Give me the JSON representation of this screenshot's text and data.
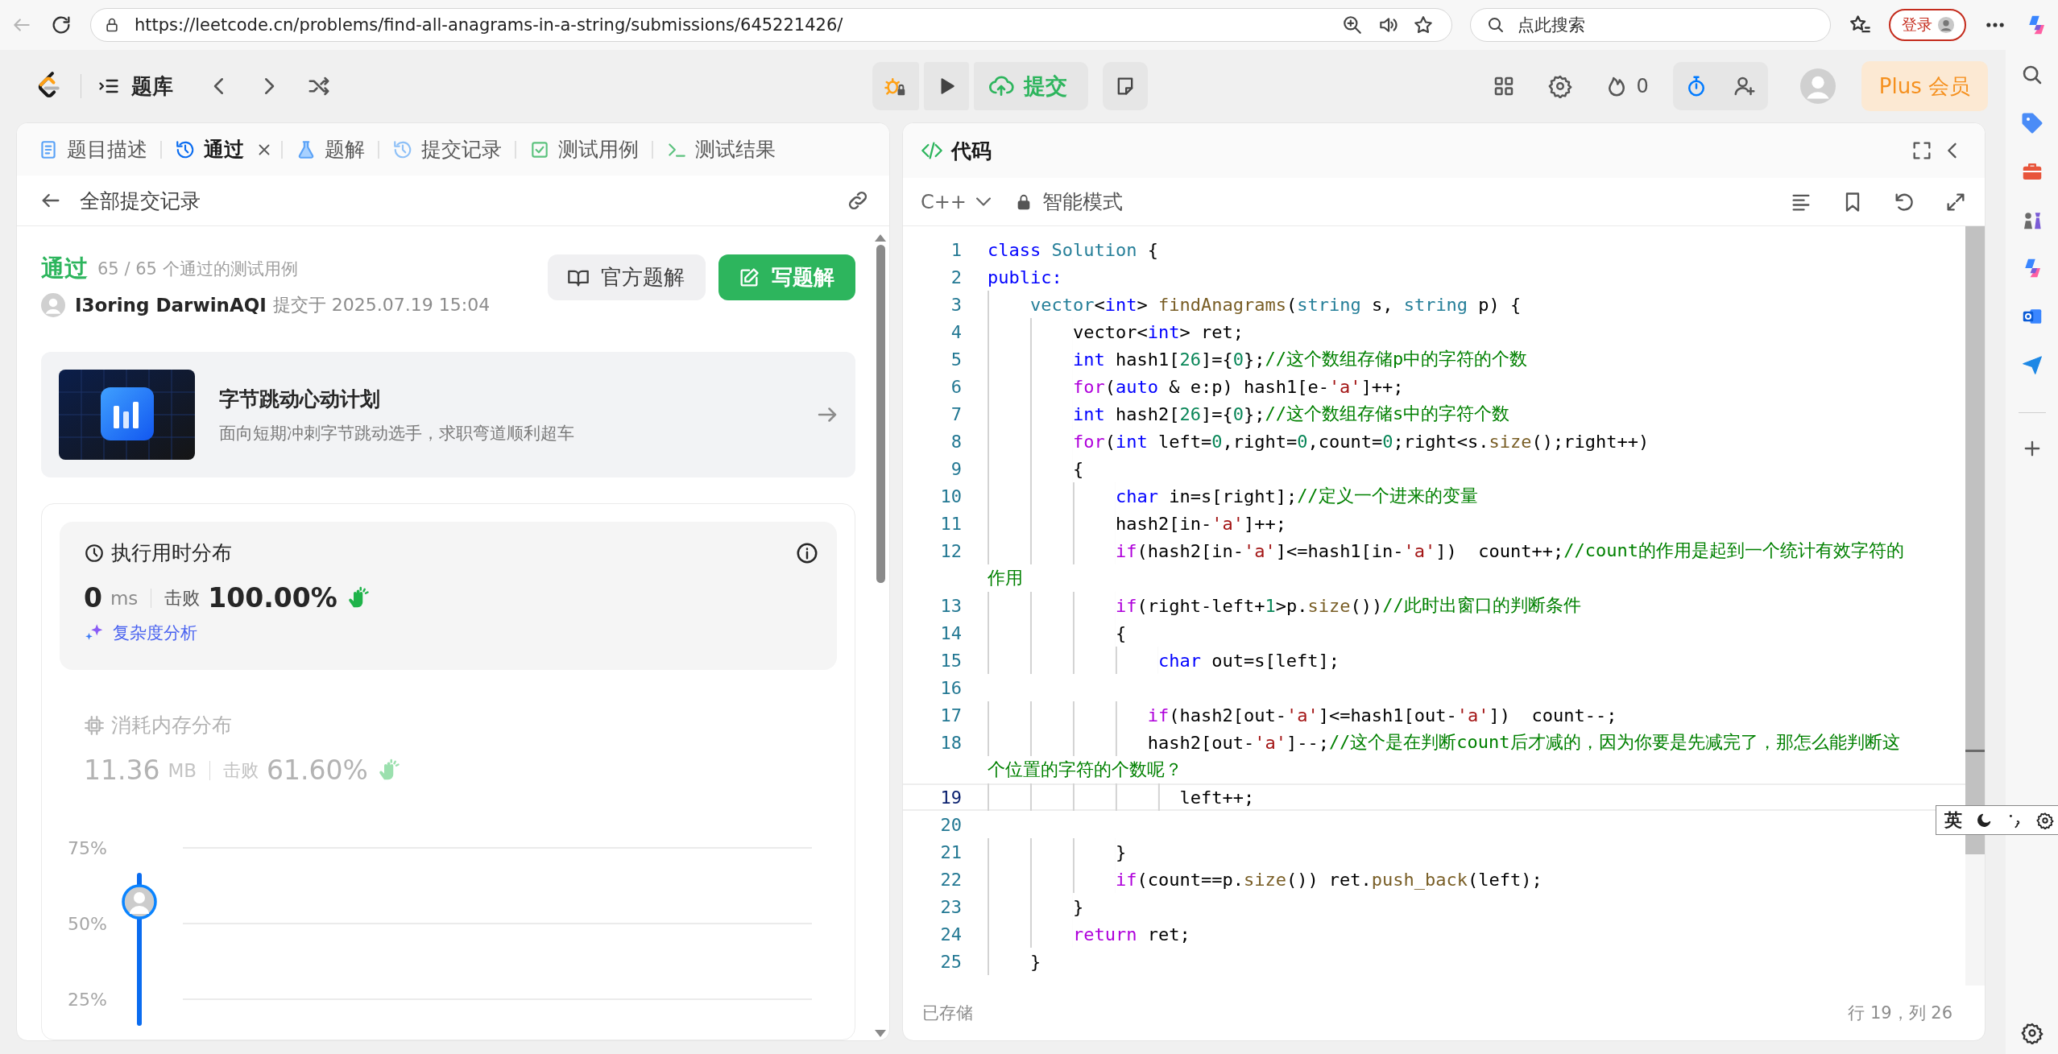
{
  "browser": {
    "url": "https://leetcode.cn/problems/find-all-anagrams-in-a-string/submissions/645221426/",
    "search": {
      "placeholder": "点此搜索"
    },
    "login": "登录"
  },
  "nav": {
    "problem_bank": "题库",
    "submit": "提交",
    "streak": "0",
    "plus": "Plus 会员"
  },
  "left_panel": {
    "tabs": [
      {
        "label": "题目描述",
        "selected": false,
        "closable": false
      },
      {
        "label": "通过",
        "selected": true,
        "closable": true
      },
      {
        "label": "题解",
        "selected": false,
        "closable": false
      },
      {
        "label": "提交记录",
        "selected": false,
        "closable": false
      },
      {
        "label": "测试用例",
        "selected": false,
        "closable": false
      },
      {
        "label": "测试结果",
        "selected": false,
        "closable": false
      }
    ],
    "back_label": "全部提交记录",
    "result": {
      "status": "通过",
      "cases": "65 / 65 个通过的测试用例",
      "user": "I3oring DarwinAQI",
      "submitted": "提交于 2025.07.19 15:04"
    },
    "buttons": [
      {
        "label": "官方题解",
        "kind": "secondary"
      },
      {
        "label": "写题解",
        "kind": "primary"
      }
    ],
    "promo": {
      "title": "字节跳动心动计划",
      "subtitle": "面向短期冲刺字节跳动选手，求职弯道顺利超车"
    },
    "metrics": [
      {
        "title": "执行用时分布",
        "value": "0",
        "unit": "ms",
        "beat_label": "击败",
        "beat": "100.00%",
        "selected": true,
        "link": "复杂度分析"
      },
      {
        "title": "消耗内存分布",
        "value": "11.36",
        "unit": "MB",
        "beat_label": "击败",
        "beat": "61.60%",
        "selected": false
      }
    ],
    "distribution": {
      "axis_labels": [
        "75%",
        "50%",
        "25%"
      ]
    }
  },
  "editor": {
    "title": "代码",
    "language": "C++",
    "mode": "智能模式",
    "saved": "已存储",
    "cursor": "行 19，列 26",
    "lines": [
      {
        "kind": "line",
        "number": "1",
        "current": false,
        "tokens": [
          {
            "kind": "kw",
            "text": "class"
          },
          {
            "kind": "type",
            "text": " Solution"
          },
          {
            "kind": "plain",
            "text": " {"
          }
        ]
      },
      {
        "kind": "line",
        "number": "2",
        "current": false,
        "tokens": [
          {
            "kind": "kw",
            "text": "public:"
          }
        ]
      },
      {
        "kind": "line",
        "number": "3",
        "current": false,
        "tokens": [
          {
            "kind": "type",
            "text": "    vector"
          },
          {
            "kind": "plain",
            "text": "<"
          },
          {
            "kind": "kw",
            "text": "int"
          },
          {
            "kind": "plain",
            "text": "> "
          },
          {
            "kind": "fn",
            "text": "findAnagrams"
          },
          {
            "kind": "plain",
            "text": "("
          },
          {
            "kind": "type",
            "text": "string"
          },
          {
            "kind": "plain",
            "text": " s, "
          },
          {
            "kind": "type",
            "text": "string"
          },
          {
            "kind": "plain",
            "text": " p) {"
          }
        ]
      },
      {
        "kind": "line",
        "number": "4",
        "current": false,
        "tokens": [
          {
            "kind": "plain",
            "text": "        vector<"
          },
          {
            "kind": "kw",
            "text": "int"
          },
          {
            "kind": "plain",
            "text": "> ret;"
          }
        ]
      },
      {
        "kind": "line",
        "number": "5",
        "current": false,
        "tokens": [
          {
            "kind": "kw",
            "text": "        int"
          },
          {
            "kind": "plain",
            "text": " hash1["
          },
          {
            "kind": "num",
            "text": "26"
          },
          {
            "kind": "plain",
            "text": "]={"
          },
          {
            "kind": "num",
            "text": "0"
          },
          {
            "kind": "plain",
            "text": "};"
          },
          {
            "kind": "cmt",
            "text": "//这个数组存储p中的字符的个数"
          }
        ]
      },
      {
        "kind": "line",
        "number": "6",
        "current": false,
        "tokens": [
          {
            "kind": "ctl",
            "text": "        for"
          },
          {
            "kind": "plain",
            "text": "("
          },
          {
            "kind": "kw",
            "text": "auto"
          },
          {
            "kind": "plain",
            "text": " & e:p) hash1[e-"
          },
          {
            "kind": "str",
            "text": "'a'"
          },
          {
            "kind": "plain",
            "text": "]++;"
          }
        ]
      },
      {
        "kind": "line",
        "number": "7",
        "current": false,
        "tokens": [
          {
            "kind": "kw",
            "text": "        int"
          },
          {
            "kind": "plain",
            "text": " hash2["
          },
          {
            "kind": "num",
            "text": "26"
          },
          {
            "kind": "plain",
            "text": "]={"
          },
          {
            "kind": "num",
            "text": "0"
          },
          {
            "kind": "plain",
            "text": "};"
          },
          {
            "kind": "cmt",
            "text": "//这个数组存储s中的字符个数"
          }
        ]
      },
      {
        "kind": "line",
        "number": "8",
        "current": false,
        "tokens": [
          {
            "kind": "ctl",
            "text": "        for"
          },
          {
            "kind": "plain",
            "text": "("
          },
          {
            "kind": "kw",
            "text": "int"
          },
          {
            "kind": "plain",
            "text": " left="
          },
          {
            "kind": "num",
            "text": "0"
          },
          {
            "kind": "plain",
            "text": ",right="
          },
          {
            "kind": "num",
            "text": "0"
          },
          {
            "kind": "plain",
            "text": ",count="
          },
          {
            "kind": "num",
            "text": "0"
          },
          {
            "kind": "plain",
            "text": ";right<s."
          },
          {
            "kind": "fn",
            "text": "size"
          },
          {
            "kind": "plain",
            "text": "();right++)"
          }
        ]
      },
      {
        "kind": "line",
        "number": "9",
        "current": false,
        "tokens": [
          {
            "kind": "plain",
            "text": "        {"
          }
        ]
      },
      {
        "kind": "line",
        "number": "10",
        "current": false,
        "tokens": [
          {
            "kind": "kw",
            "text": "            char"
          },
          {
            "kind": "plain",
            "text": " in=s[right];"
          },
          {
            "kind": "cmt",
            "text": "//定义一个进来的变量"
          }
        ]
      },
      {
        "kind": "line",
        "number": "11",
        "current": false,
        "tokens": [
          {
            "kind": "plain",
            "text": "            hash2[in-"
          },
          {
            "kind": "str",
            "text": "'a'"
          },
          {
            "kind": "plain",
            "text": "]++;"
          }
        ]
      },
      {
        "kind": "line",
        "number": "12",
        "current": false,
        "tokens": [
          {
            "kind": "ctl",
            "text": "            if"
          },
          {
            "kind": "plain",
            "text": "(hash2[in-"
          },
          {
            "kind": "str",
            "text": "'a'"
          },
          {
            "kind": "plain",
            "text": "]<=hash1[in-"
          },
          {
            "kind": "str",
            "text": "'a'"
          },
          {
            "kind": "plain",
            "text": "])  count++;"
          },
          {
            "kind": "cmt",
            "text": "//count的作用是起到一个统计有效字符的"
          }
        ]
      },
      {
        "kind": "wrap",
        "tokens": [
          {
            "kind": "cmt",
            "text": "作用"
          }
        ]
      },
      {
        "kind": "line",
        "number": "13",
        "current": false,
        "tokens": [
          {
            "kind": "ctl",
            "text": "            if"
          },
          {
            "kind": "plain",
            "text": "(right-left+"
          },
          {
            "kind": "num",
            "text": "1"
          },
          {
            "kind": "plain",
            "text": ">p."
          },
          {
            "kind": "fn",
            "text": "size"
          },
          {
            "kind": "plain",
            "text": "())"
          },
          {
            "kind": "cmt",
            "text": "//此时出窗口的判断条件"
          }
        ]
      },
      {
        "kind": "line",
        "number": "14",
        "current": false,
        "tokens": [
          {
            "kind": "plain",
            "text": "            {"
          }
        ]
      },
      {
        "kind": "line",
        "number": "15",
        "current": false,
        "tokens": [
          {
            "kind": "kw",
            "text": "                char"
          },
          {
            "kind": "plain",
            "text": " out=s[left];"
          }
        ]
      },
      {
        "kind": "line",
        "number": "16",
        "current": false
      },
      {
        "kind": "line",
        "number": "17",
        "current": false,
        "tokens": [
          {
            "kind": "ctl",
            "text": "               if"
          },
          {
            "kind": "plain",
            "text": "(hash2[out-"
          },
          {
            "kind": "str",
            "text": "'a'"
          },
          {
            "kind": "plain",
            "text": "]<=hash1[out-"
          },
          {
            "kind": "str",
            "text": "'a'"
          },
          {
            "kind": "plain",
            "text": "])  count--;"
          }
        ]
      },
      {
        "kind": "line",
        "number": "18",
        "current": false,
        "tokens": [
          {
            "kind": "plain",
            "text": "               hash2[out-"
          },
          {
            "kind": "str",
            "text": "'a'"
          },
          {
            "kind": "plain",
            "text": "]--;"
          },
          {
            "kind": "cmt",
            "text": "//这个是在判断count后才减的，因为你要是先减完了，那怎么能判断这"
          }
        ]
      },
      {
        "kind": "wrap",
        "tokens": [
          {
            "kind": "cmt",
            "text": "个位置的字符的个数呢？"
          }
        ]
      },
      {
        "kind": "line",
        "number": "19",
        "current": true,
        "tokens": [
          {
            "kind": "plain",
            "text": "                  left++;"
          }
        ]
      },
      {
        "kind": "line",
        "number": "20",
        "current": false
      },
      {
        "kind": "line",
        "number": "21",
        "current": false,
        "tokens": [
          {
            "kind": "plain",
            "text": "            }"
          }
        ]
      },
      {
        "kind": "line",
        "number": "22",
        "current": false,
        "tokens": [
          {
            "kind": "ctl",
            "text": "            if"
          },
          {
            "kind": "plain",
            "text": "(count==p."
          },
          {
            "kind": "fn",
            "text": "size"
          },
          {
            "kind": "plain",
            "text": "()) ret."
          },
          {
            "kind": "fn",
            "text": "push_back"
          },
          {
            "kind": "plain",
            "text": "(left);"
          }
        ]
      },
      {
        "kind": "line",
        "number": "23",
        "current": false,
        "tokens": [
          {
            "kind": "plain",
            "text": "        }"
          }
        ]
      },
      {
        "kind": "line",
        "number": "24",
        "current": false,
        "tokens": [
          {
            "kind": "ctl",
            "text": "        return"
          },
          {
            "kind": "plain",
            "text": " ret;"
          }
        ]
      },
      {
        "kind": "line",
        "number": "25",
        "current": false,
        "tokens": [
          {
            "kind": "plain",
            "text": "    }"
          }
        ]
      }
    ]
  },
  "ime": {
    "label": "英"
  }
}
